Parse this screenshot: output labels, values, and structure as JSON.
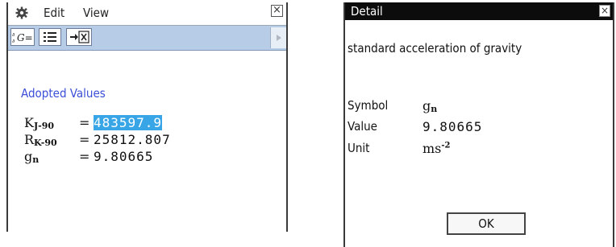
{
  "left_window": {
    "menu": {
      "edit": "Edit",
      "view": "View",
      "close": "×"
    },
    "toolbar": {
      "btn1_label": "G="
    },
    "section_title": "Adopted Values",
    "rows": [
      {
        "symbol": "K",
        "subscript": "J-90",
        "equals": "=",
        "value": "483597.9",
        "selected": true
      },
      {
        "symbol": "R",
        "subscript": "K-90",
        "equals": "=",
        "value": "25812.807",
        "selected": false
      },
      {
        "symbol": "g",
        "subscript": "n",
        "equals": "=",
        "value": "9.80665",
        "selected": false
      }
    ]
  },
  "detail_dialog": {
    "title": "Detail",
    "close": "×",
    "description": "standard acceleration of gravity",
    "symbol_label": "Symbol",
    "symbol_base": "g",
    "symbol_sub": "n",
    "value_label": "Value",
    "value": "9.80665",
    "unit_label": "Unit",
    "unit_base": "ms",
    "unit_exp": "-2",
    "ok_label": "OK"
  },
  "colors": {
    "selection": "#38a6e6",
    "section_title": "#3b4fd8",
    "toolbar": "#b7cce6",
    "dialog_titlebar": "#0c0c0c"
  },
  "icons": [
    "gear-icon",
    "graph-equation-icon",
    "list-icon",
    "insert-x-icon",
    "close-icon",
    "scroll-right-icon"
  ]
}
